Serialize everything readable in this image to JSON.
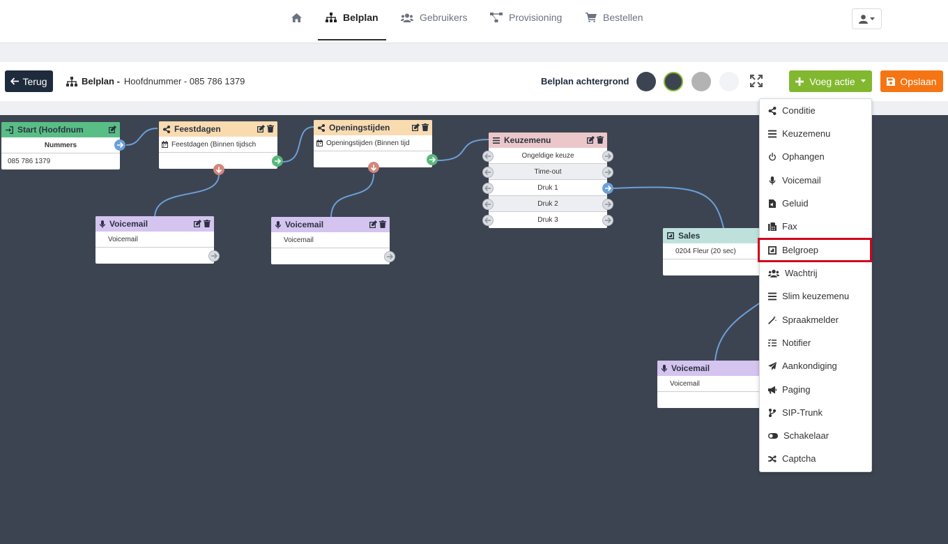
{
  "nav": {
    "items": [
      {
        "label": ""
      },
      {
        "label": "Belplan"
      },
      {
        "label": "Gebruikers"
      },
      {
        "label": "Provisioning"
      },
      {
        "label": "Bestellen"
      }
    ]
  },
  "toolbar": {
    "back_label": "Terug",
    "breadcrumb_bold": "Belplan -",
    "breadcrumb_rest": "Hoofdnummer - 085 786 1379",
    "background_label": "Belplan achtergrond",
    "swatches": [
      "#3d4451",
      "#3d4451",
      "#b3b3b3",
      "#f2f3f7"
    ],
    "add_action_label": "Voeg actie",
    "save_label": "Opslaan"
  },
  "nodes": {
    "start": {
      "title": "Start (Hoofdnum",
      "header_row": "Nummers",
      "row": "085 786 1379"
    },
    "feestdagen": {
      "title": "Feestdagen",
      "row": "Feestdagen (Binnen tijdsch"
    },
    "openingstijden": {
      "title": "Openingstijden",
      "row": "Openingstijden (Binnen tijd"
    },
    "keuzemenu": {
      "title": "Keuzemenu",
      "rows": [
        "Ongeldige keuze",
        "Time-out",
        "Druk 1",
        "Druk 2",
        "Druk 3"
      ]
    },
    "voicemail1": {
      "title": "Voicemail",
      "row": "Voicemail"
    },
    "voicemail2": {
      "title": "Voicemail",
      "row": "Voicemail"
    },
    "sales": {
      "title": "Sales",
      "row": "0204 Fleur (20 sec)"
    },
    "voicemail3": {
      "title": "Voicemail",
      "row": "Voicemail"
    }
  },
  "menu": {
    "items": [
      {
        "label": "Conditie",
        "icon": "share-icon"
      },
      {
        "label": "Keuzemenu",
        "icon": "list-icon"
      },
      {
        "label": "Ophangen",
        "icon": "power-icon"
      },
      {
        "label": "Voicemail",
        "icon": "microphone-icon"
      },
      {
        "label": "Geluid",
        "icon": "audio-file-icon"
      },
      {
        "label": "Fax",
        "icon": "fax-icon"
      },
      {
        "label": "Belgroep",
        "icon": "group-square-icon"
      },
      {
        "label": "Wachtrij",
        "icon": "users-icon"
      },
      {
        "label": "Slim keuzemenu",
        "icon": "list-icon"
      },
      {
        "label": "Spraakmelder",
        "icon": "magic-wand-icon"
      },
      {
        "label": "Notifier",
        "icon": "tasks-icon"
      },
      {
        "label": "Aankondiging",
        "icon": "paper-plane-icon"
      },
      {
        "label": "Paging",
        "icon": "megaphone-icon"
      },
      {
        "label": "SIP-Trunk",
        "icon": "branch-icon"
      },
      {
        "label": "Schakelaar",
        "icon": "toggle-icon"
      },
      {
        "label": "Captcha",
        "icon": "shuffle-icon"
      }
    ],
    "highlighted": "Belgroep"
  }
}
